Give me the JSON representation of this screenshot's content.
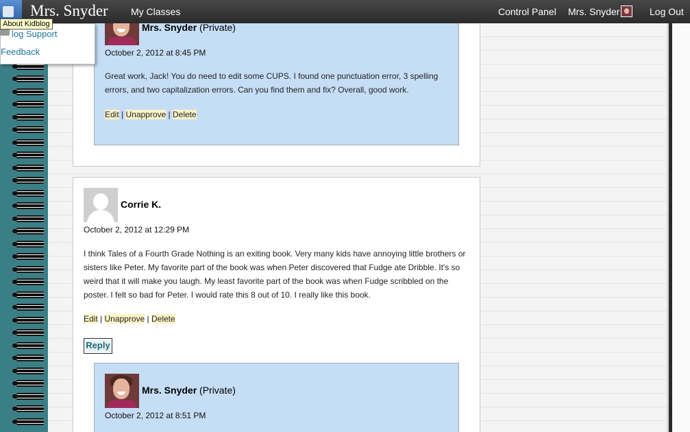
{
  "topbar": {
    "site_title": "Mrs. Snyder",
    "nav": {
      "my_classes": "My Classes",
      "control_panel": "Control Panel",
      "user_name": "Mrs. Snyder",
      "log_out": "Log Out"
    }
  },
  "dropdown": {
    "tooltip": "About Kidblog",
    "items": [
      "log Support",
      "Feedback"
    ]
  },
  "comments": [
    {
      "reply": {
        "author": "Mrs. Snyder",
        "visibility": "(Private)",
        "date": "October 2, 2012 at 8:45 PM",
        "text": "Great work, Jack! You do need to edit some CUPS. I found one punctuation error, 3 spelling errors, and two capitalization errors. Can you find them and fix? Overall, good work.",
        "actions": [
          "Edit",
          "Unapprove",
          "Delete"
        ]
      }
    },
    {
      "author": "Corrie K.",
      "date": "October 2, 2012 at 12:29 PM",
      "text": "I think Tales of a Fourth Grade Nothing is an exiting book. Very many kids have annoying little brothers or sisters like Peter. My favorite part of the book was when Peter discovered that Fudge ate Dribble. It's so weird that it will make you laugh. My least favorite part of the book was when Fudge scribbled on the poster. I felt so bad for Peter. I would rate this 8 out of 10. I really like this book.",
      "actions": [
        "Edit",
        "Unapprove",
        "Delete"
      ],
      "reply_button": "Reply",
      "reply": {
        "author": "Mrs. Snyder",
        "visibility": "(Private)",
        "date": "October 2, 2012 at 8:51 PM"
      }
    }
  ],
  "colors": {
    "topbar": "#2f2f2f",
    "background": "#3b7f86",
    "reply_box": "#c5ddf5",
    "action_highlight": "#fbf4c7",
    "link": "#21759b"
  }
}
